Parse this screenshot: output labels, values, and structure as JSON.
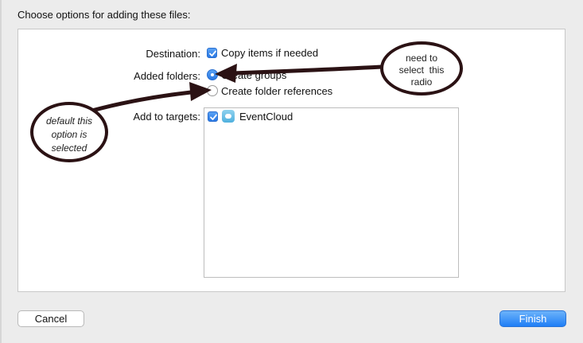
{
  "dialog": {
    "title": "Choose options for adding these files:"
  },
  "destination": {
    "label": "Destination:",
    "option_label": "Copy items if needed",
    "checked": true
  },
  "added_folders": {
    "label": "Added folders:",
    "options": [
      {
        "label": "Create groups",
        "selected": true
      },
      {
        "label": "Create folder references",
        "selected": false
      }
    ]
  },
  "targets": {
    "label": "Add to targets:",
    "items": [
      {
        "label": "EventCloud",
        "checked": true,
        "icon": "cloud-app-icon"
      }
    ]
  },
  "buttons": {
    "cancel": "Cancel",
    "finish": "Finish"
  },
  "annotations": {
    "right_note": [
      "need to",
      "select  this",
      "radio"
    ],
    "left_note": [
      "default this",
      "option is",
      "selected"
    ],
    "color": "#2b1214"
  },
  "colors": {
    "accent": "#2a78e4",
    "background": "#ececec"
  }
}
